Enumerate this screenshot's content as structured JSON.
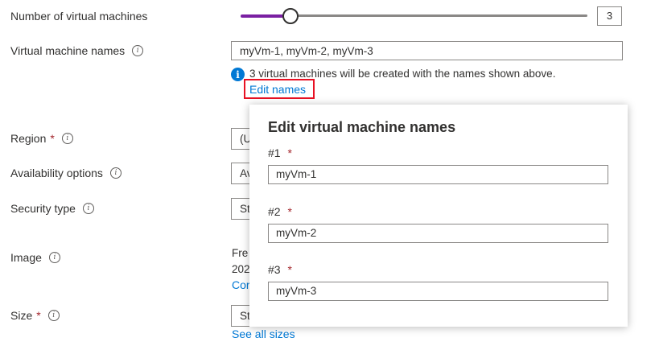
{
  "vm_count": {
    "label": "Number of virtual machines",
    "value": "3",
    "slider_fraction": 0.14
  },
  "vm_names": {
    "label": "Virtual machine names",
    "value": "myVm-1, myVm-2, myVm-3",
    "note": "3 virtual machines will be created with the names shown above.",
    "edit_link": "Edit names"
  },
  "region": {
    "label": "Region",
    "required": "*",
    "value": "(U"
  },
  "availability": {
    "label": "Availability options",
    "value": "Av"
  },
  "security": {
    "label": "Security type",
    "value": "St"
  },
  "image": {
    "label": "Image",
    "line1": "Fre",
    "line2": "202",
    "link": "Cor"
  },
  "size": {
    "label": "Size",
    "required": "*",
    "value": "St",
    "see_all": "See all sizes"
  },
  "callout": {
    "title": "Edit virtual machine names",
    "items": [
      {
        "label": "#1",
        "required": "*",
        "value": "myVm-1"
      },
      {
        "label": "#2",
        "required": "*",
        "value": "myVm-2"
      },
      {
        "label": "#3",
        "required": "*",
        "value": "myVm-3"
      }
    ]
  },
  "colors": {
    "accent": "#0078d4",
    "slider": "#7a1fa2",
    "required": "#a4262c",
    "highlight": "#e81123"
  }
}
